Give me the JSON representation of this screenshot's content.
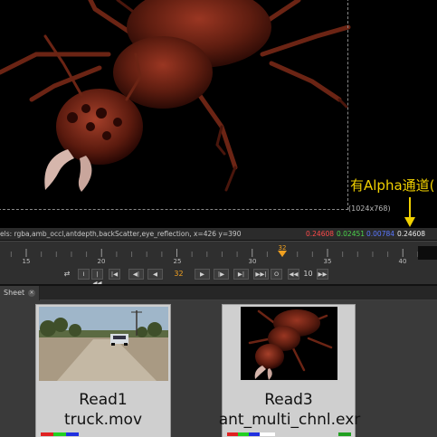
{
  "viewer": {
    "resolution_label": "(1024x768)",
    "alpha_note": "有Alpha通道(",
    "info_text": "els: rgba,amb_occl,antdepth,backScatter,eye_reflection,  x=426 y=390",
    "pixel_values": {
      "r": "0.24608",
      "g": "0.02451",
      "b": "0.00784",
      "a": "0.24608"
    },
    "colors": {
      "red": "#ff4a4a",
      "green": "#4cd44c",
      "blue": "#5a78ff",
      "alpha": "#eeeeee",
      "note": "#f0d000"
    }
  },
  "timeline": {
    "tick_labels": [
      "15",
      "20",
      "25",
      "30",
      "35",
      "40"
    ],
    "current_frame": "32",
    "frame_field": "32",
    "step_value": "10",
    "buttons": {
      "loop": "⇄",
      "in_point": "I",
      "first": "|◀◀",
      "prev_key": "|◀",
      "prev_frame": "◀|",
      "play_back": "◀",
      "play_fwd": "▶",
      "next_frame": "|▶",
      "next_key": "▶|",
      "last": "▶▶|",
      "out_point": "O",
      "step_back": "◀◀",
      "step_fwd": "▶▶"
    }
  },
  "tab": {
    "label": "Sheet",
    "close": "×"
  },
  "nodes": [
    {
      "name": "Read1",
      "file": "truck.mov"
    },
    {
      "name": "Read3",
      "file": "ant_multi_chnl.exr"
    }
  ]
}
